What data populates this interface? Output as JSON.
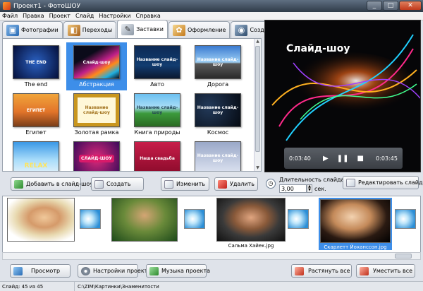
{
  "window": {
    "title": "Проект1 - ФотоШОУ",
    "minimize": "_",
    "maximize": "□",
    "close": "✕"
  },
  "menu": [
    "Файл",
    "Правка",
    "Проект",
    "Слайд",
    "Настройки",
    "Справка"
  ],
  "tabs": [
    {
      "label": "Фотографии",
      "icon": "photos-icon"
    },
    {
      "label": "Переходы",
      "icon": "transitions-icon"
    },
    {
      "label": "Заставки",
      "icon": "intro-icon"
    },
    {
      "label": "Оформление",
      "icon": "design-icon"
    },
    {
      "label": "Создать",
      "icon": "create-icon"
    }
  ],
  "gallery": {
    "items": [
      {
        "label": "The end",
        "text": "THE END"
      },
      {
        "label": "Абстракция",
        "text": "Слайд-шоу",
        "selected": true
      },
      {
        "label": "Авто",
        "text": "Название слайд-шоу"
      },
      {
        "label": "Дорога",
        "text": "Название слайд-шоу"
      },
      {
        "label": "Египет",
        "text": "ЕГИПЕТ"
      },
      {
        "label": "Золотая рамка",
        "text": "Название слайд-шоу"
      },
      {
        "label": "Книга природы",
        "text": "Название слайд-шоу"
      },
      {
        "label": "Космос",
        "text": "Название слайд-шоу"
      },
      {
        "label": "",
        "text": "RELAX"
      },
      {
        "label": "",
        "text": "СЛАЙД-ШОУ"
      },
      {
        "label": "",
        "text": "Наша свадьба"
      },
      {
        "label": "",
        "text": "Название слайд-шоу"
      }
    ]
  },
  "gallery_buttons": {
    "add": "Добавить в слайд-шоу",
    "create": "Создать",
    "edit": "Изменить",
    "delete": "Удалить"
  },
  "preview": {
    "title": "Слайд-шоу",
    "time_current": "0:03:40",
    "time_total": "0:03:45",
    "play": "▶",
    "pause": "❚❚",
    "stop": "■"
  },
  "duration": {
    "label": "Длительность слайда:",
    "value": "3,00",
    "unit": "сек.",
    "edit_button": "Редактировать слайд"
  },
  "timeline": [
    {
      "label": ""
    },
    {
      "label": ""
    },
    {
      "label": "Сальма Хайек.jpg"
    },
    {
      "label": "Скарлетт Йоханссон.jpg",
      "selected": true
    }
  ],
  "bottom_buttons": {
    "preview": "Просмотр",
    "settings": "Настройки проекта",
    "music": "Музыка проекта",
    "stretch": "Растянуть все",
    "fit": "Уместить все"
  },
  "status": {
    "slide": "Слайд: 45 из 45",
    "path": "C:\\ZIM\\Картинки\\Знаменитости"
  }
}
